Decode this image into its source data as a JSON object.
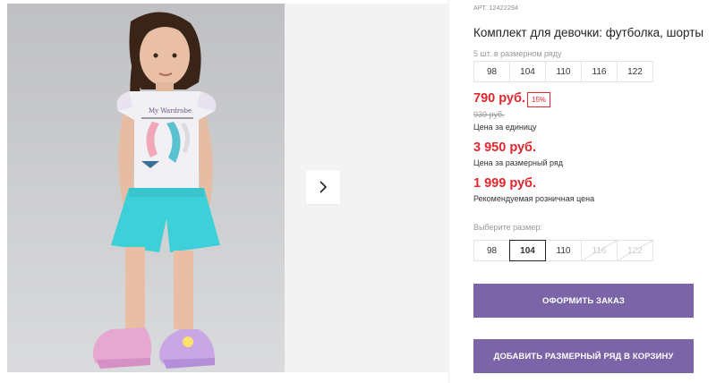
{
  "product": {
    "sku": "АРТ. 12422294",
    "title": "Комплект для девочки: футболка, шорты"
  },
  "pack": {
    "note": "5 шт. в размерном ряду",
    "sizes": [
      "98",
      "104",
      "110",
      "116",
      "122"
    ]
  },
  "pricing": {
    "unit_price": "790 руб.",
    "discount": "15%",
    "old_price": "930 руб.",
    "unit_label": "Цена за единицу",
    "pack_price": "3 950 руб.",
    "pack_label": "Цена за размерный ряд",
    "rrp_price": "1 999 руб.",
    "rrp_label": "Рекомендуемая розничная цена",
    "accent_color": "#e3272f"
  },
  "size_picker": {
    "label": "Выберите размер:",
    "options": [
      {
        "size": "98",
        "state": "available"
      },
      {
        "size": "104",
        "state": "selected"
      },
      {
        "size": "110",
        "state": "available"
      },
      {
        "size": "116",
        "state": "unavailable"
      },
      {
        "size": "122",
        "state": "unavailable"
      }
    ]
  },
  "actions": {
    "order_label": "ОФОРМИТЬ ЗАКАЗ",
    "add_pack_label": "ДОБАВИТЬ РАЗМЕРНЫЙ РЯД В КОРЗИНУ",
    "button_color": "#7b64a8"
  },
  "gallery": {
    "next_icon": "chevron-right-icon",
    "shirt_text": "My Wardrobe"
  }
}
